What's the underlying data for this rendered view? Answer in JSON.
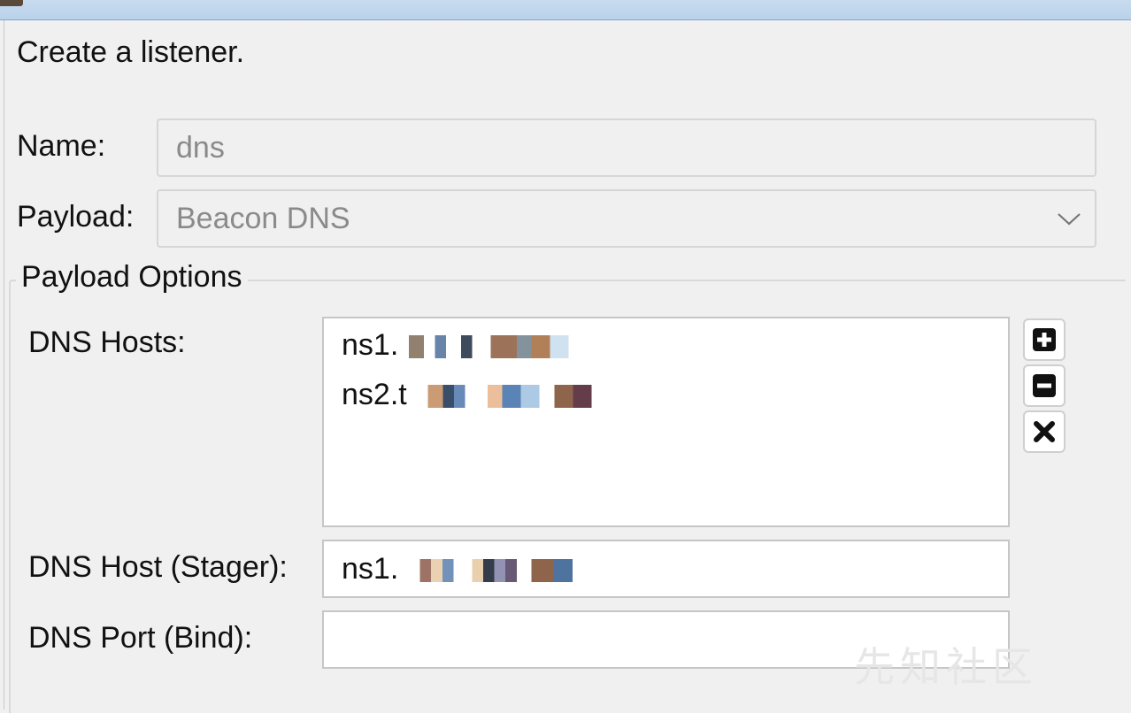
{
  "dialog": {
    "description": "Create a listener."
  },
  "form": {
    "name_label": "Name:",
    "name_value": "dns",
    "payload_label": "Payload:",
    "payload_value": "Beacon DNS"
  },
  "payload_options": {
    "title": "Payload Options",
    "dns_hosts_label": "DNS Hosts:",
    "dns_hosts": [
      "ns1.",
      "ns2.t"
    ],
    "stager_label": "DNS Host (Stager):",
    "stager_value": "ns1.",
    "port_label": "DNS Port (Bind):",
    "port_value": ""
  },
  "buttons": {
    "add_icon": "plus-square-icon",
    "remove_icon": "minus-square-icon",
    "clear_icon": "x-icon"
  },
  "watermark": "先知社区",
  "colors": {
    "field_border": "#d6d6d6",
    "disabled_text": "#8a8a8a",
    "titlebar": "#c9dcef"
  }
}
